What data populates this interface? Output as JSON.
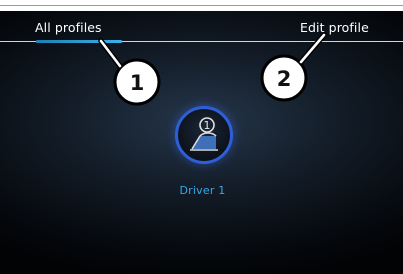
{
  "tabs": [
    {
      "label": "All profiles",
      "active": true
    },
    {
      "label": "Edit profile",
      "active": false
    }
  ],
  "callouts": [
    "1",
    "2"
  ],
  "profiles": [
    {
      "name": "Driver 1",
      "number": "1",
      "selected": true
    }
  ],
  "colors": {
    "accent": "#3bb2ea",
    "profile_ring": "#2f5fd8",
    "profile_name": "#3aa6e6"
  },
  "icons": {
    "profile": "driver-seat-icon"
  }
}
